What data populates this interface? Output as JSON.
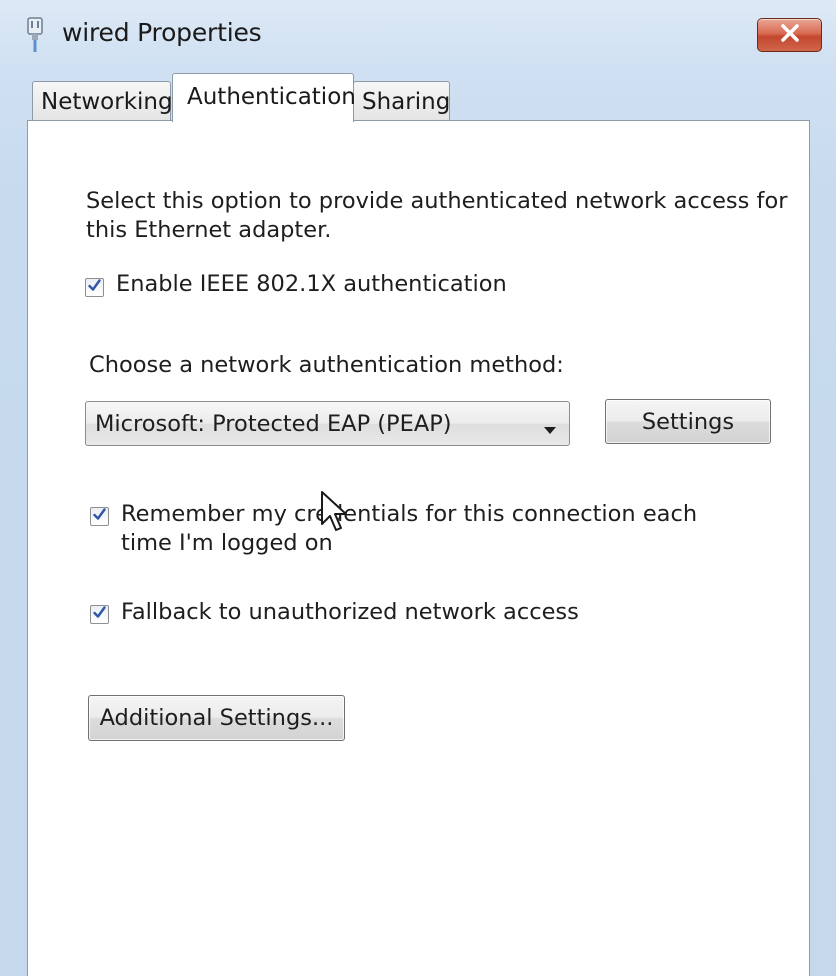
{
  "window": {
    "title": "wired Properties",
    "icon": "network-adapter-icon",
    "close_icon": "close-icon",
    "close_color": "#c94a31"
  },
  "tabs": [
    {
      "label": "Networking",
      "active": false
    },
    {
      "label": "Authentication",
      "active": true
    },
    {
      "label": "Sharing",
      "active": false
    }
  ],
  "authentication": {
    "description": "Select this option to provide authenticated network access for\nthis Ethernet adapter.",
    "enable_8021x": {
      "label": "Enable IEEE 802.1X authentication",
      "checked": true
    },
    "method_label": "Choose a network authentication method:",
    "method_select": {
      "value": "Microsoft: Protected EAP (PEAP)"
    },
    "settings_button": "Settings",
    "remember_credentials": {
      "label": "Remember my credentials for this connection each\ntime I'm logged on",
      "checked": true
    },
    "fallback": {
      "label": "Fallback to unauthorized network access",
      "checked": true
    },
    "additional_settings_button": "Additional Settings..."
  },
  "colors": {
    "check_mark": "#2f55a4",
    "titlebar": "#cfe0f2"
  }
}
